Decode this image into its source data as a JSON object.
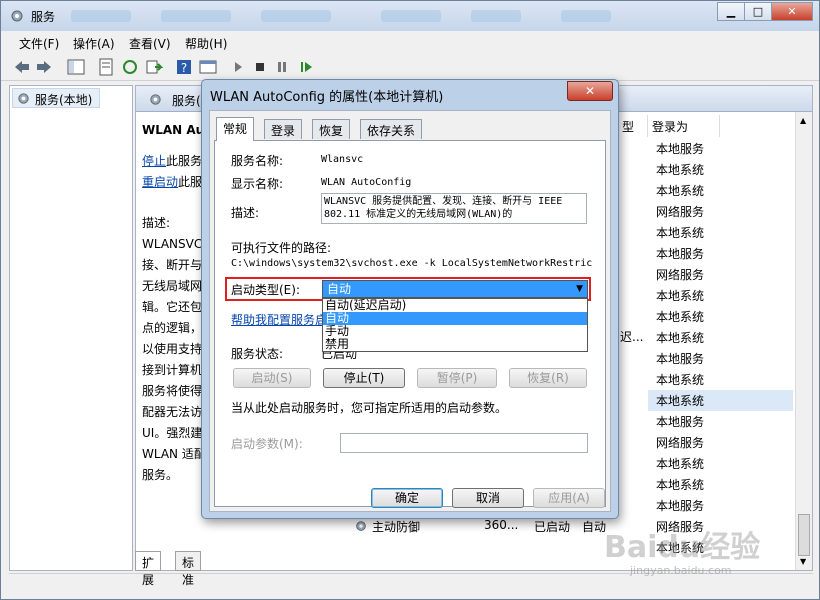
{
  "window": {
    "title": "服务"
  },
  "menu": [
    "文件(F)",
    "操作(A)",
    "查看(V)",
    "帮助(H)"
  ],
  "tree": {
    "root": "服务(本地)"
  },
  "panel_header": "服务(本",
  "desc": {
    "service_name": "WLAN Au",
    "stop_link": "停止",
    "stop_suffix": "此服务",
    "restart_link": "重启动",
    "restart_suffix": "此服",
    "lines": [
      "描述:",
      "WLANSVC",
      "接、断开与",
      "无线局域网",
      "辑。它还包",
      "点的逻辑，",
      "以使用支持",
      "接到计算机",
      "服务将使得",
      "配器无法访",
      "UI。强烈建",
      "WLAN 适配",
      "服务。"
    ]
  },
  "columns": {
    "type_partial": "型",
    "logon": "登录为"
  },
  "logon_rows": [
    "本地服务",
    "本地系统",
    "本地系统",
    "网络服务",
    "本地系统",
    "本地服务",
    "网络服务",
    "本地系统",
    "本地系统",
    "本地系统",
    "本地服务",
    "本地系统",
    "本地系统",
    "本地服务",
    "网络服务",
    "本地系统",
    "本地系统",
    "本地服务",
    "网络服务",
    "本地系统"
  ],
  "partial_cell": "迟...",
  "bottom_row": {
    "name": "主动防御",
    "desc": "360...",
    "status": "已启动",
    "startup": "自动"
  },
  "bottom_tabs": [
    "扩展",
    "标准"
  ],
  "dialog": {
    "title": "WLAN AutoConfig 的属性(本地计算机)",
    "close": "✕",
    "tabs": [
      "常规",
      "登录",
      "恢复",
      "依存关系"
    ],
    "service_name_label": "服务名称:",
    "service_name": "Wlansvc",
    "display_name_label": "显示名称:",
    "display_name": "WLAN AutoConfig",
    "desc_label": "描述:",
    "description": "WLANSVC 服务提供配置、发现、连接、断开与 IEEE 802.11 标准定义的无线局域网(WLAN)的",
    "exe_label": "可执行文件的路径:",
    "exe_path": "C:\\windows\\system32\\svchost.exe -k LocalSystemNetworkRestric",
    "startup_label": "启动类型(E):",
    "startup_value": "自动",
    "startup_options": [
      "自动(延迟启动)",
      "自动",
      "手动",
      "禁用"
    ],
    "help_link": "帮助我配置服务启",
    "status_label": "服务状态:",
    "status_value": "已启动",
    "buttons": {
      "start": "启动(S)",
      "stop": "停止(T)",
      "pause": "暂停(P)",
      "resume": "恢复(R)"
    },
    "hint": "当从此处启动服务时，您可指定所适用的启动参数。",
    "param_label": "启动参数(M):",
    "param_value": "",
    "ok": "确定",
    "cancel": "取消",
    "apply": "应用(A)"
  },
  "watermark": {
    "brand": "Baidu经验",
    "url": "jingyan.baidu.com"
  }
}
